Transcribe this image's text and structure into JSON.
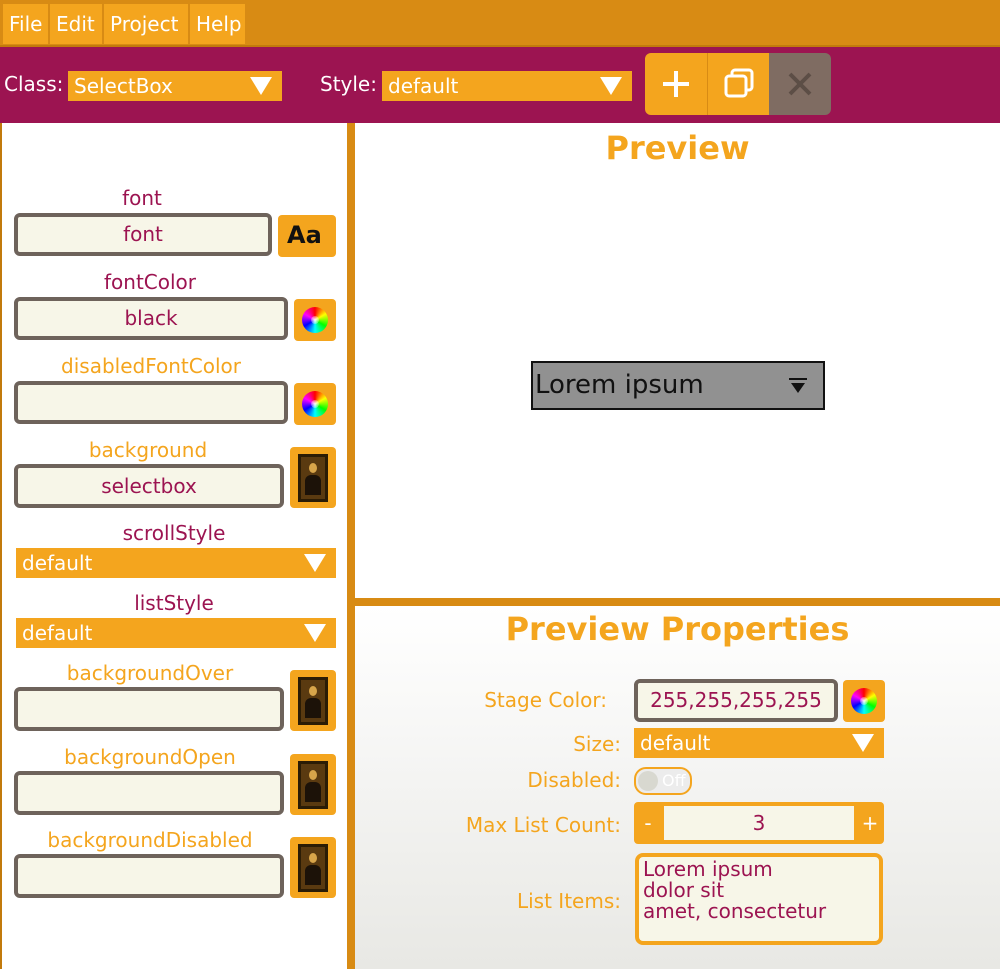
{
  "menu": {
    "items": [
      {
        "label": "File"
      },
      {
        "label": "Edit"
      },
      {
        "label": "Project"
      },
      {
        "label": "Help"
      }
    ]
  },
  "toolbar": {
    "class_label": "Class:",
    "class_value": "SelectBox",
    "style_label": "Style:",
    "style_value": "default",
    "buttons": {
      "new_icon": "plus-icon",
      "duplicate_icon": "duplicate-icon",
      "delete_icon": "close-icon"
    }
  },
  "properties": {
    "font": {
      "label": "font",
      "value": "font",
      "icon": "font-icon",
      "icon_text": "Aa"
    },
    "fontColor": {
      "label": "fontColor",
      "value": "black",
      "icon": "color-wheel-icon"
    },
    "disabledFontColor": {
      "label": "disabledFontColor",
      "value": "",
      "icon": "color-wheel-icon"
    },
    "background": {
      "label": "background",
      "value": "selectbox",
      "icon": "picture-icon"
    },
    "scrollStyle": {
      "label": "scrollStyle",
      "value": "default"
    },
    "listStyle": {
      "label": "listStyle",
      "value": "default"
    },
    "backgroundOver": {
      "label": "backgroundOver",
      "value": "",
      "icon": "picture-icon"
    },
    "backgroundOpen": {
      "label": "backgroundOpen",
      "value": "",
      "icon": "picture-icon"
    },
    "backgroundDisabled": {
      "label": "backgroundDisabled",
      "value": "",
      "icon": "picture-icon"
    }
  },
  "preview": {
    "title": "Preview",
    "selectbox_text": "Lorem ipsum"
  },
  "preview_properties": {
    "title": "Preview Properties",
    "stage_color_label": "Stage Color:",
    "stage_color_value": "255,255,255,255",
    "size_label": "Size:",
    "size_value": "default",
    "disabled_label": "Disabled:",
    "disabled_state": "Off",
    "max_list_count_label": "Max List Count:",
    "max_list_count_value": "3",
    "minus": "-",
    "plus": "+",
    "list_items_label": "List Items:",
    "list_items": [
      "Lorem ipsum",
      "dolor sit",
      "amet, consectetur"
    ]
  },
  "colors": {
    "menubar": "#d88b14",
    "accent_orange": "#f4a51e",
    "toolbar_magenta": "#9c1451",
    "text_magenta": "#9c1451",
    "field_bg": "#f7f6e8",
    "field_border": "#6e635b",
    "preview_select_bg": "#919191"
  }
}
